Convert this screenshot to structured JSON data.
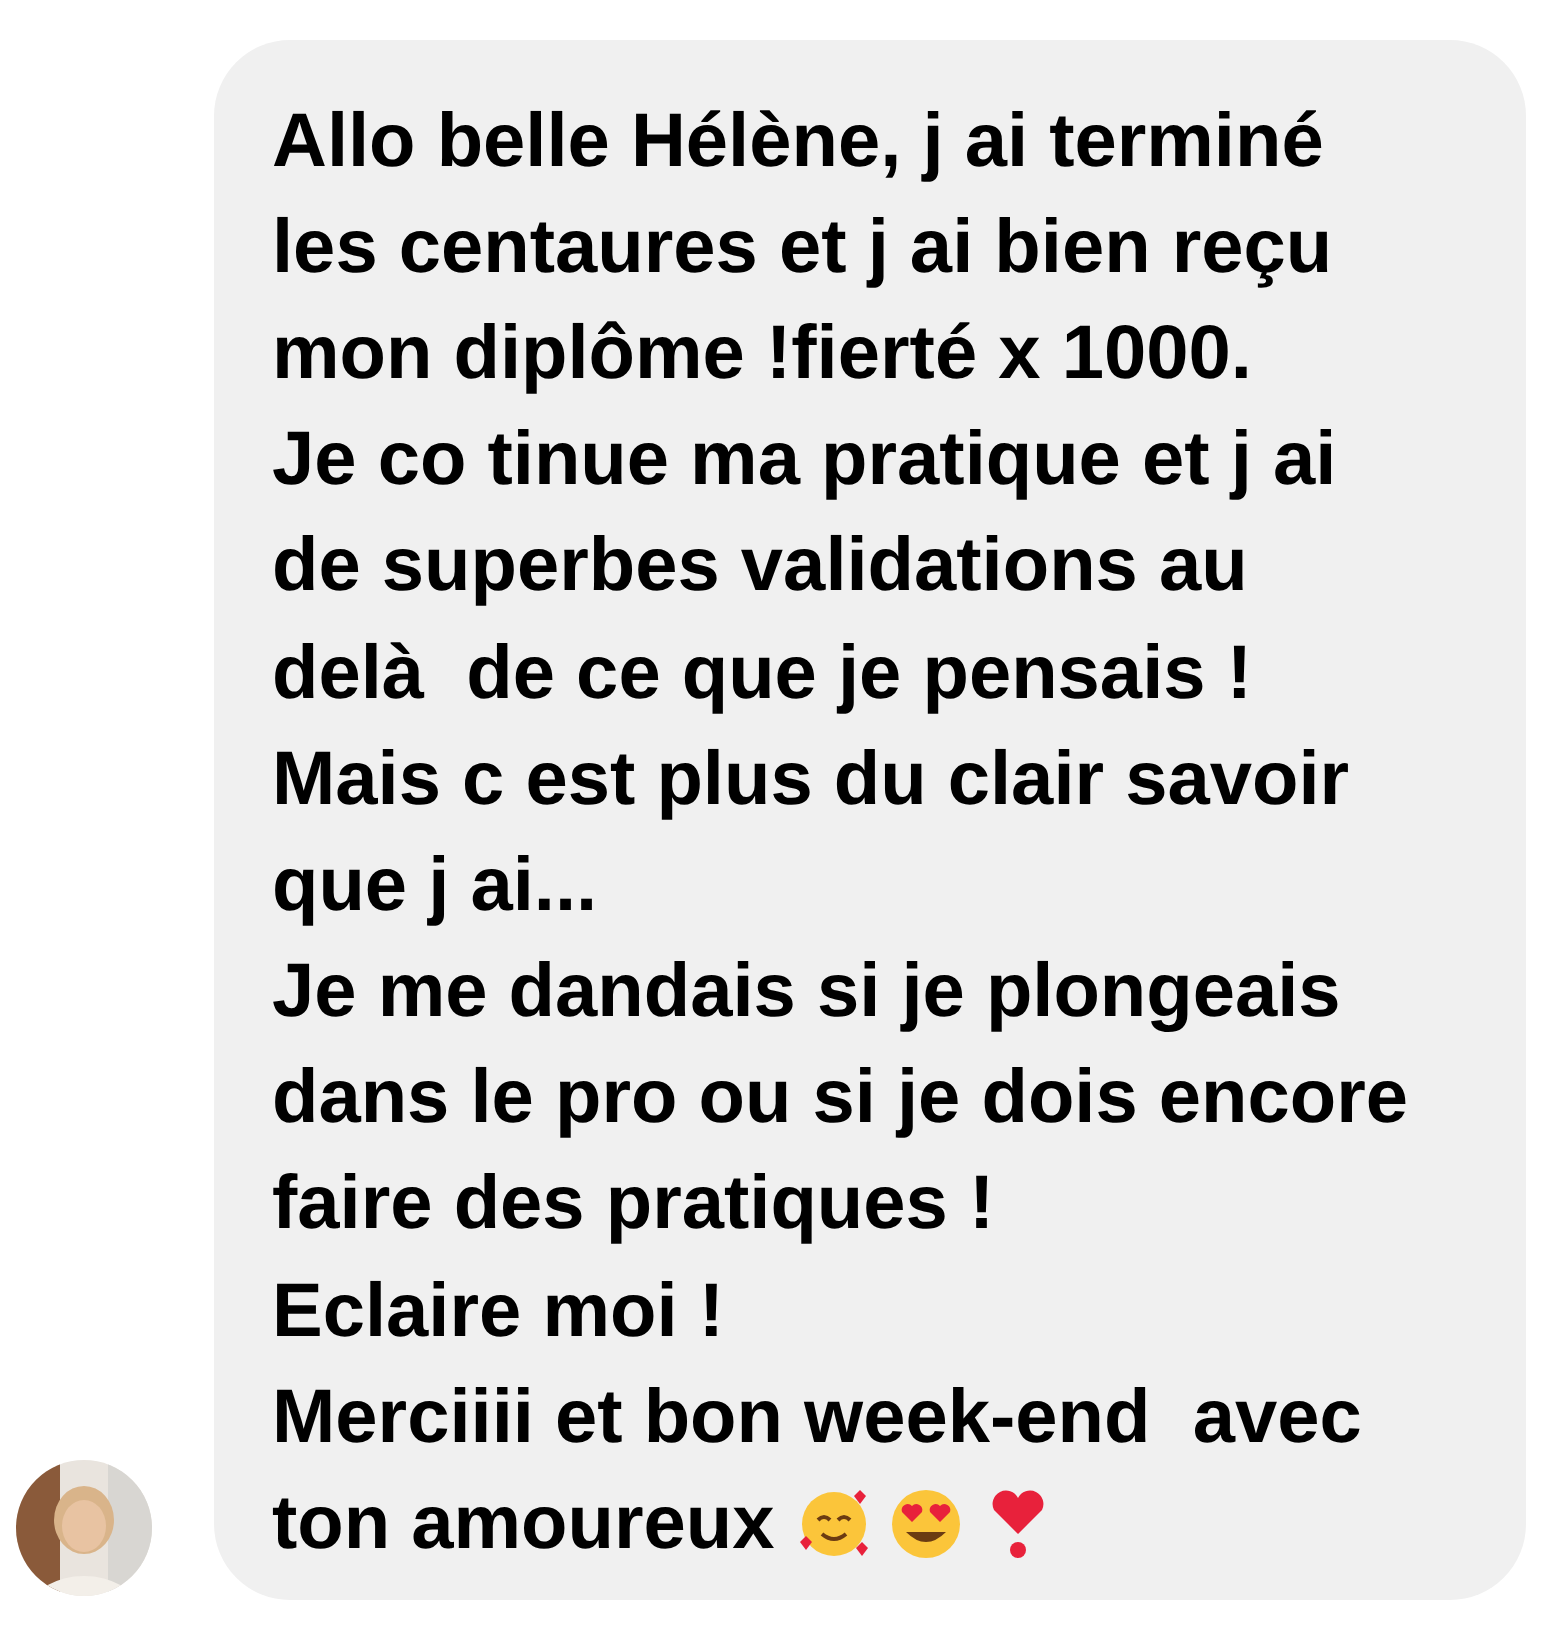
{
  "message": {
    "lines": [
      {
        "text": "Allo belle Hélène, j ai terminé"
      },
      {
        "text": "les centaures et j ai bien reçu"
      },
      {
        "text": "mon diplôme !fierté x 1000."
      },
      {
        "text": "Je co tinue ma pratique et j ai"
      },
      {
        "text": "de superbes validations au"
      },
      {
        "text": "delà  de ce que je pensais !"
      },
      {
        "text": "Mais c est plus du clair savoir"
      },
      {
        "text": "que j ai..."
      },
      {
        "text": "Je me dandais si je plongeais"
      },
      {
        "text": "dans le pro ou si je dois encore"
      },
      {
        "text": "faire des pratiques !"
      },
      {
        "text": "Eclaire moi !"
      },
      {
        "text": "Merciiii et bon week-end  avec"
      },
      {
        "text": "ton amoureux",
        "emojis": [
          {
            "kind": "smiling-hearts"
          },
          {
            "kind": "heart-eyes"
          },
          {
            "kind": "heart-exclamation"
          }
        ]
      }
    ]
  }
}
